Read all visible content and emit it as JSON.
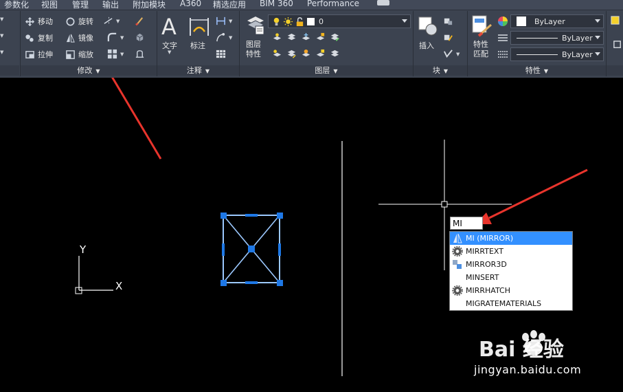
{
  "tabs": [
    "参数化",
    "视图",
    "管理",
    "输出",
    "附加模块",
    "A360",
    "精选应用",
    "BIM 360",
    "Performance"
  ],
  "modify_panel": {
    "move": "移动",
    "rotate": "旋转",
    "copy": "复制",
    "mirror": "镜像",
    "stretch": "拉伸",
    "scale": "缩放",
    "footer": "修改"
  },
  "annotation_panel": {
    "text": "文字",
    "dimension": "标注",
    "footer": "注释"
  },
  "layers_panel": {
    "layer_properties": "图层\n特性",
    "current_layer": "0",
    "footer": "图层"
  },
  "block_panel": {
    "insert": "插入",
    "footer": "块"
  },
  "properties_panel": {
    "match": "特性\n匹配",
    "color": "ByLayer",
    "linetype": "ByLayer",
    "lineweight": "ByLayer",
    "footer": "特性"
  },
  "ucs": {
    "x_label": "X",
    "y_label": "Y"
  },
  "command": {
    "input_value": "MI"
  },
  "autocomplete": [
    {
      "label": "MI (MIRROR)",
      "icon": "mirror-icon",
      "selected": true
    },
    {
      "label": "MIRRTEXT",
      "icon": "gear-icon",
      "selected": false
    },
    {
      "label": "MIRROR3D",
      "icon": "mirror3d-icon",
      "selected": false
    },
    {
      "label": "MINSERT",
      "icon": "",
      "selected": false
    },
    {
      "label": "MIRRHATCH",
      "icon": "gear-icon",
      "selected": false
    },
    {
      "label": "MIGRATEMATERIALS",
      "icon": "",
      "selected": false
    }
  ],
  "watermark": {
    "logo": "Bai 经验",
    "url": "jingyan.baidu.com"
  },
  "colors": {
    "ribbon_bg": "#3c4350",
    "annotation_arrow": "#e8342c",
    "grip": "#1e78e6",
    "selection": "#3390ff"
  }
}
